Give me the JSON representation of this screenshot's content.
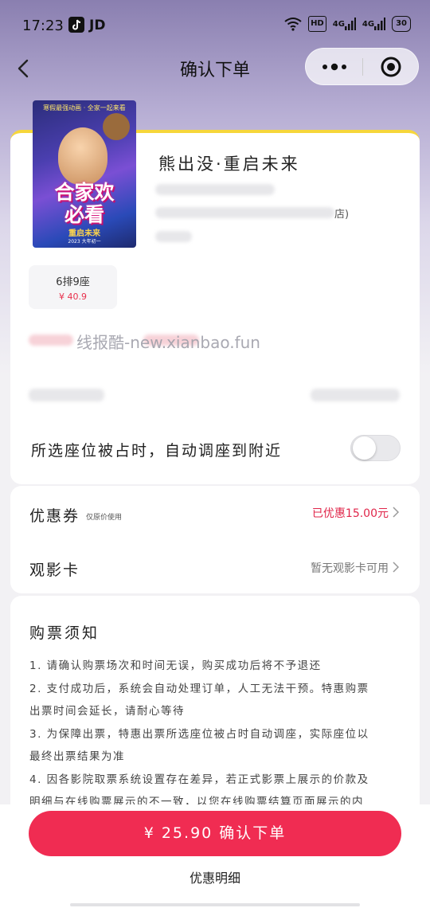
{
  "status_bar": {
    "time": "17:23",
    "app_icon": "tiktok-icon",
    "carrier": "JD",
    "hd_label": "HD",
    "signal1": "4G",
    "signal2": "4G",
    "battery": "30"
  },
  "nav": {
    "title": "确认下单",
    "back_icon": "back-chevron-icon",
    "more_icon": "more-dots-icon",
    "close_icon": "miniapp-close-icon"
  },
  "movie": {
    "title": "熊出没·重启未来",
    "poster": {
      "tagline": "寒假最强动画 · 全家一起来看",
      "title_line1": "合家欢",
      "title_line2": "必看",
      "subtitle": "重启未来",
      "date": "2023 大年初一"
    },
    "info_line_suffix": "店)"
  },
  "seat": {
    "name": "6排9座",
    "price": "¥ 40.9"
  },
  "watermark": "线报酷-new.xianbao.fun",
  "auto_seat": {
    "label": "所选座位被占时，自动调座到附近",
    "enabled": false
  },
  "coupon": {
    "label": "优惠券",
    "sub": "仅原价使用",
    "value": "已优惠15.00元",
    "value_color": "#e0264a"
  },
  "card_row": {
    "label": "观影卡",
    "value": "暂无观影卡可用"
  },
  "notice": {
    "title": "购票须知",
    "lines": [
      "1. 请确认购票场次和时间无误，购买成功后将不予退还",
      "2. 支付成功后，系统会自动处理订单，人工无法干预。特惠购票",
      "出票时间会延长，请耐心等待",
      "3. 为保障出票，特惠出票所选座位被占时自动调座，实际座位以",
      "最终出票结果为准",
      "4. 因各影院取票系统设置存在差异，若正式影票上展示的价款及",
      "明细与在线购票展示的不一致，以您在线购票结算页面展示的内"
    ]
  },
  "footer": {
    "confirm_label": "¥ 25.90 确认下单",
    "detail_label": "优惠明细",
    "accent": "#f02c52"
  }
}
